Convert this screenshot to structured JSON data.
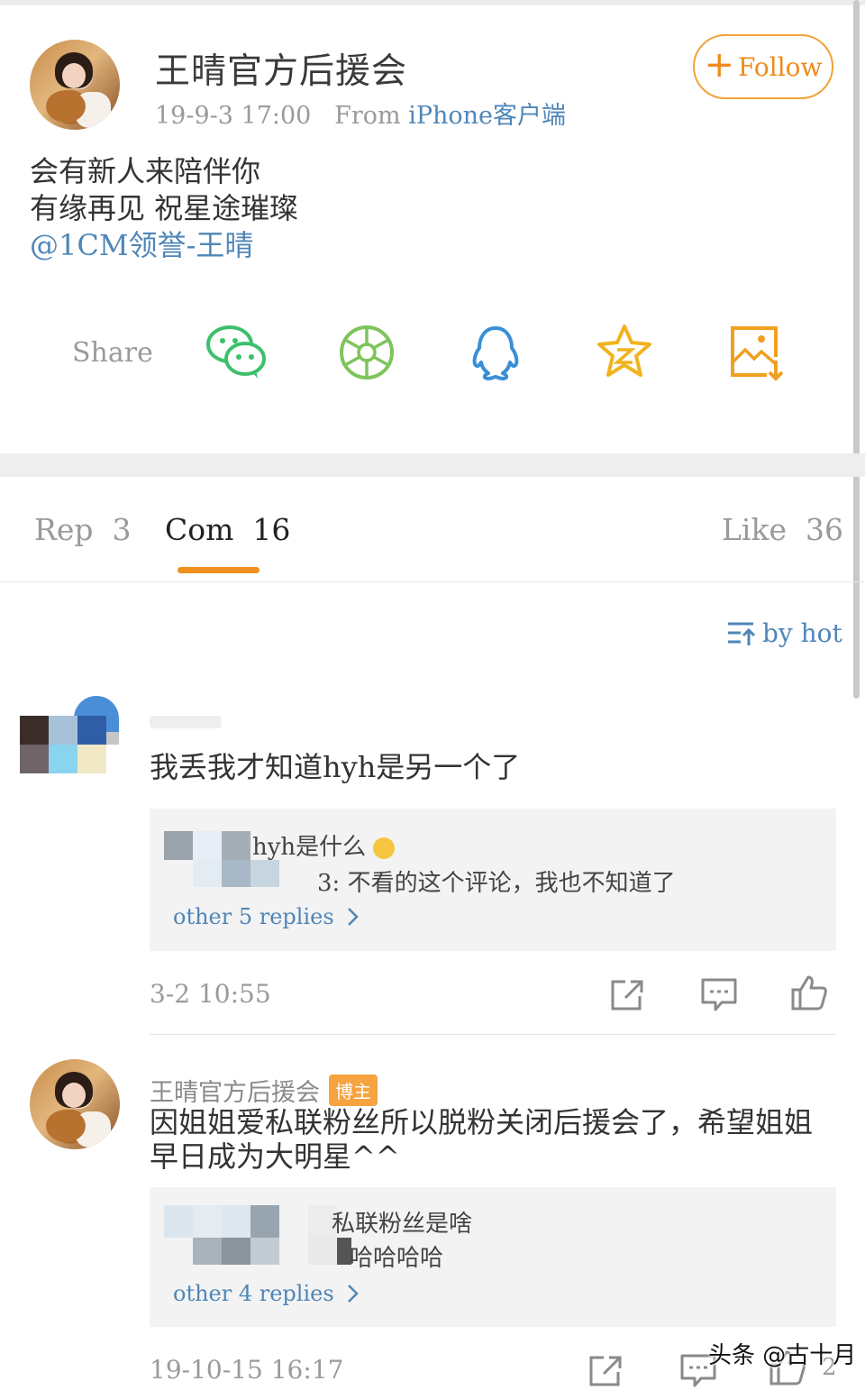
{
  "post": {
    "author": "王晴官方后援会",
    "time": "19-9-3 17:00",
    "from_label": "From",
    "source": "iPhone客户端",
    "follow_label": "Follow",
    "lines": [
      "会有新人来陪伴你",
      "有缘再见 祝星途璀璨"
    ],
    "mention": "@1CM领誉-王晴"
  },
  "share": {
    "label": "Share",
    "icons": [
      "wechat-icon",
      "moments-icon",
      "qq-icon",
      "qzone-star-icon",
      "save-image-icon"
    ]
  },
  "tabs": [
    {
      "label": "Rep",
      "count": "3"
    },
    {
      "label": "Com",
      "count": "16",
      "active": true
    },
    {
      "label": "Like",
      "count": "36"
    }
  ],
  "sort": {
    "label": "by  hot"
  },
  "comments": [
    {
      "text": "我丢我才知道hyh是另一个了",
      "replies": [
        "hyh是什么",
        "3: 不看的这个评论，我也不知道了"
      ],
      "more": "other  5  replies",
      "time": "3-2  10:55"
    },
    {
      "author": "王晴官方后援会",
      "badge": "博主",
      "text_lines": [
        "因姐姐爱私联粉丝所以脱粉关闭后援会了，希望姐姐",
        "早日成为大明星^^"
      ],
      "replies": [
        "私联粉丝是啥",
        "哈哈哈哈"
      ],
      "more": "other  4  replies",
      "time": "19-10-15  16:17",
      "like_count": "2"
    }
  ],
  "watermark": "头条 @古十月",
  "colors": {
    "accent": "#f08f1e",
    "link": "#4f86b8",
    "follow": "#ee8b1b",
    "wechat": "#3cc06b",
    "moments": "#7ec45a",
    "qq": "#3a8fd6",
    "qzone": "#f2b21e",
    "save": "#f0a020"
  }
}
